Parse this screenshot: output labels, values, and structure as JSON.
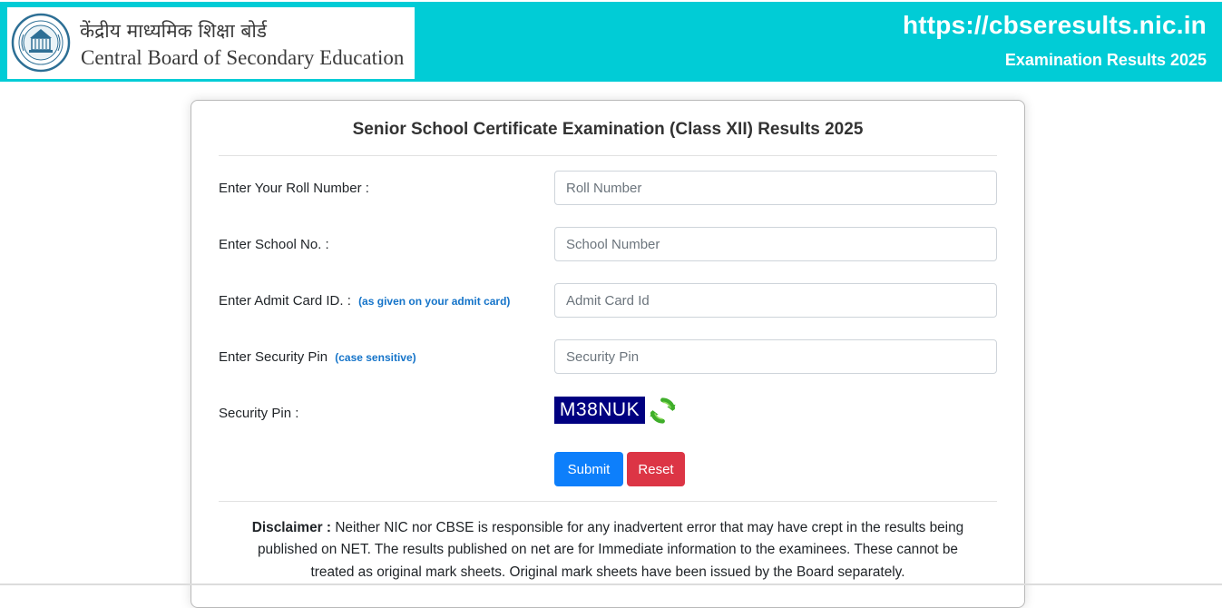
{
  "header": {
    "hindi_name": "केंद्रीय माध्यमिक शिक्षा बोर्ड",
    "english_name": "Central Board of Secondary Education",
    "site_url": "https://cbseresults.nic.in",
    "subtitle": "Examination Results 2025"
  },
  "form": {
    "title": "Senior School Certificate Examination (Class XII) Results 2025",
    "roll_label": "Enter Your Roll Number :",
    "roll_placeholder": "Roll Number",
    "school_label": "Enter School No. :",
    "school_placeholder": "School Number",
    "admit_label": "Enter Admit Card ID. :",
    "admit_hint": "(as given on your admit card)",
    "admit_placeholder": "Admit Card Id",
    "pin_label": "Enter Security Pin",
    "pin_hint": "(case sensitive)",
    "pin_placeholder": "Security Pin",
    "captcha_label": "Security Pin :",
    "captcha_value": "M38NUK",
    "captcha_refresh_icon": "refresh-icon",
    "submit_label": "Submit",
    "reset_label": "Reset"
  },
  "disclaimer": {
    "heading": "Disclaimer :",
    "text": "Neither NIC nor CBSE is responsible for any inadvertent error that may have crept in the results being published on NET. The results published on net are for Immediate information to the examinees. These cannot be treated as original mark sheets. Original mark sheets have been issued by the Board separately."
  },
  "colors": {
    "header_bg": "#01ccd6",
    "submit_bg": "#0d7ffb",
    "reset_bg": "#dc3545",
    "captcha_bg": "#000080",
    "hint_text": "#1574c9"
  }
}
